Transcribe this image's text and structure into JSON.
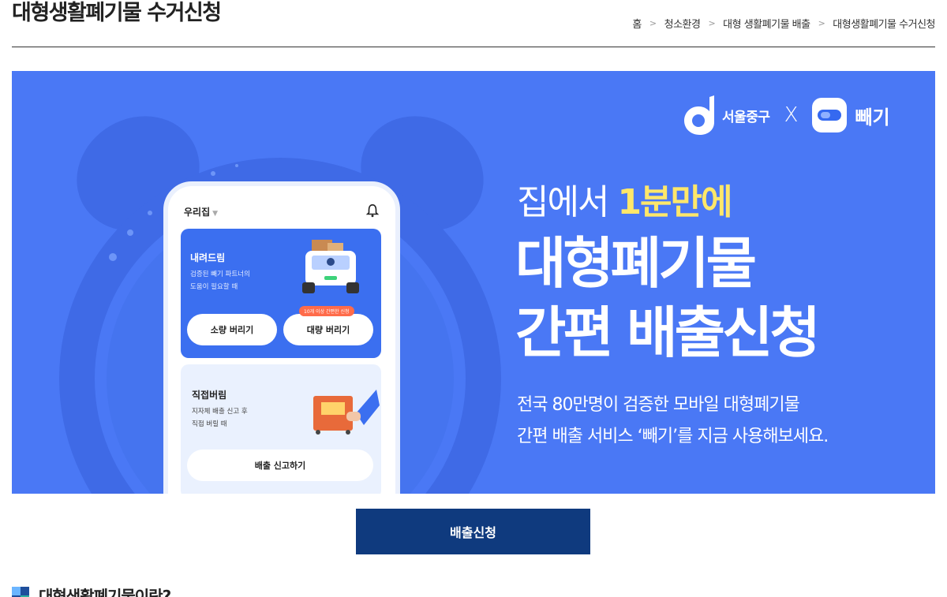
{
  "header": {
    "title": "대형생활폐기물 수거신청",
    "breadcrumb": [
      "홈",
      "청소환경",
      "대형 생활폐기물 배출",
      "대형생활폐기물 수거신청"
    ]
  },
  "banner": {
    "partner_name": "서울중구",
    "times": "X",
    "app_name": "빼기",
    "headline_prefix": "집에서 ",
    "headline_highlight": "1분만에",
    "headline_line1": "대형폐기물",
    "headline_line2": "간편 배출신청",
    "sub_line1": "전국 80만명이 검증한 모바일 대형폐기물",
    "sub_line2": "간편 배출 서비스 ‘빼기’를 지금 사용해보세요.",
    "phone": {
      "location": "우리집",
      "card1_title": "내려드림",
      "card1_desc1": "검증된 빼기 파트너의",
      "card1_desc2": "도움이 필요할 때",
      "tag": "10개 이상 간편한 신청",
      "btn_small": "소량 버리기",
      "btn_large": "대량 버리기",
      "card2_title": "직접버림",
      "card2_desc1": "지자체 배출 신고 후",
      "card2_desc2": "직접 버릴 때",
      "btn_report": "배출 신고하기"
    },
    "colors": {
      "background": "#4a78f5",
      "highlight": "#ffe76a",
      "card": "#3b6ff0"
    }
  },
  "cta": {
    "label": "배출신청",
    "color": "#0f3a7e"
  },
  "section": {
    "title": "대형생활폐기물이란?"
  }
}
